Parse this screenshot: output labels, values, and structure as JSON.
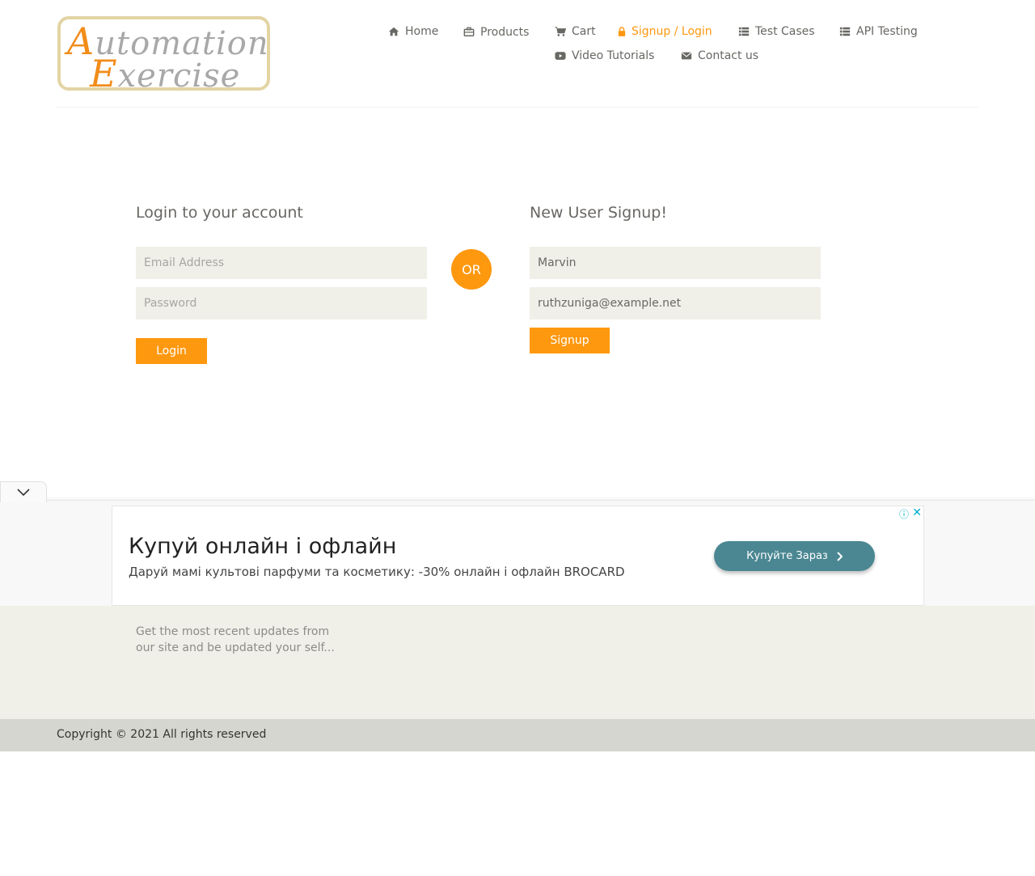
{
  "logo": {
    "line1_initial": "A",
    "line1_rest": "utomation",
    "line2_initial": "E",
    "line2_rest": "xercise"
  },
  "nav": {
    "home": {
      "label": "Home",
      "icon": "home-icon"
    },
    "products": {
      "label": "Products",
      "icon": "briefcase-icon"
    },
    "cart": {
      "label": "Cart",
      "icon": "cart-icon"
    },
    "login": {
      "label": "Signup / Login",
      "icon": "lock-icon",
      "active": true
    },
    "test_cases": {
      "label": "Test Cases",
      "icon": "list-icon"
    },
    "api_testing": {
      "label": "API Testing",
      "icon": "list-icon"
    },
    "video": {
      "label": "Video Tutorials",
      "icon": "youtube-icon"
    },
    "contact": {
      "label": "Contact us",
      "icon": "envelope-icon"
    }
  },
  "login_form": {
    "title": "Login to your account",
    "email_placeholder": "Email Address",
    "email_value": "",
    "password_placeholder": "Password",
    "password_value": "",
    "button": "Login"
  },
  "or_label": "OR",
  "signup_form": {
    "title": "New User Signup!",
    "name_value": "Marvin",
    "email_value": "ruthzuniga@example.net",
    "button": "Signup"
  },
  "ad": {
    "title": "Купуй онлайн і офлайн",
    "subtitle": "Даруй мамі культові парфуми та косметику: -30% онлайн і офлайн BROCARD",
    "cta": "Купуйте Зараз",
    "info_icon": "info-icon",
    "close_icon": "close-icon",
    "collapse_icon": "chevron-down-icon"
  },
  "footer": {
    "subscribe_text": "Get the most recent updates from our site and be updated your self...",
    "copyright": "Copyright © 2021 All rights reserved"
  },
  "colors": {
    "accent": "#fe980f",
    "input_bg": "#f0f0e9",
    "footer_bg": "#f0f0e9",
    "footer_bottom_bg": "#d6d6d0",
    "ad_cta": "#4a8792"
  }
}
